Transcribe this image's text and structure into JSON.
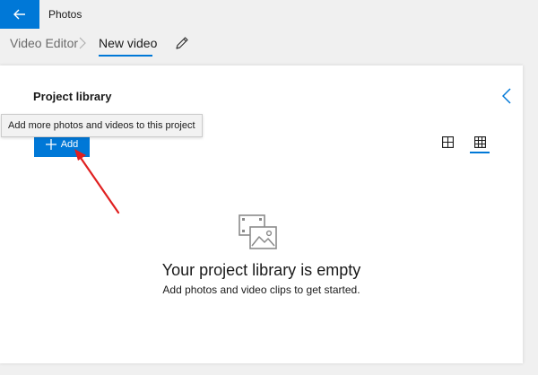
{
  "app": {
    "title": "Photos"
  },
  "breadcrumb": {
    "parent": "Video Editor",
    "current": "New video"
  },
  "library": {
    "title": "Project library",
    "add_label": "Add",
    "tooltip": "Add more photos and videos to this project",
    "empty_title": "Your project library is empty",
    "empty_subtitle": "Add photos and video clips to get started."
  },
  "icons": {
    "back": "back-arrow-icon",
    "rename": "pencil-icon",
    "collapse": "chevron-left-icon",
    "add": "plus-icon",
    "view_large": "large-grid-icon",
    "view_small": "small-grid-icon",
    "empty": "photo-film-icon"
  },
  "colors": {
    "accent": "#0078d7",
    "annotation_arrow": "#e02020"
  }
}
